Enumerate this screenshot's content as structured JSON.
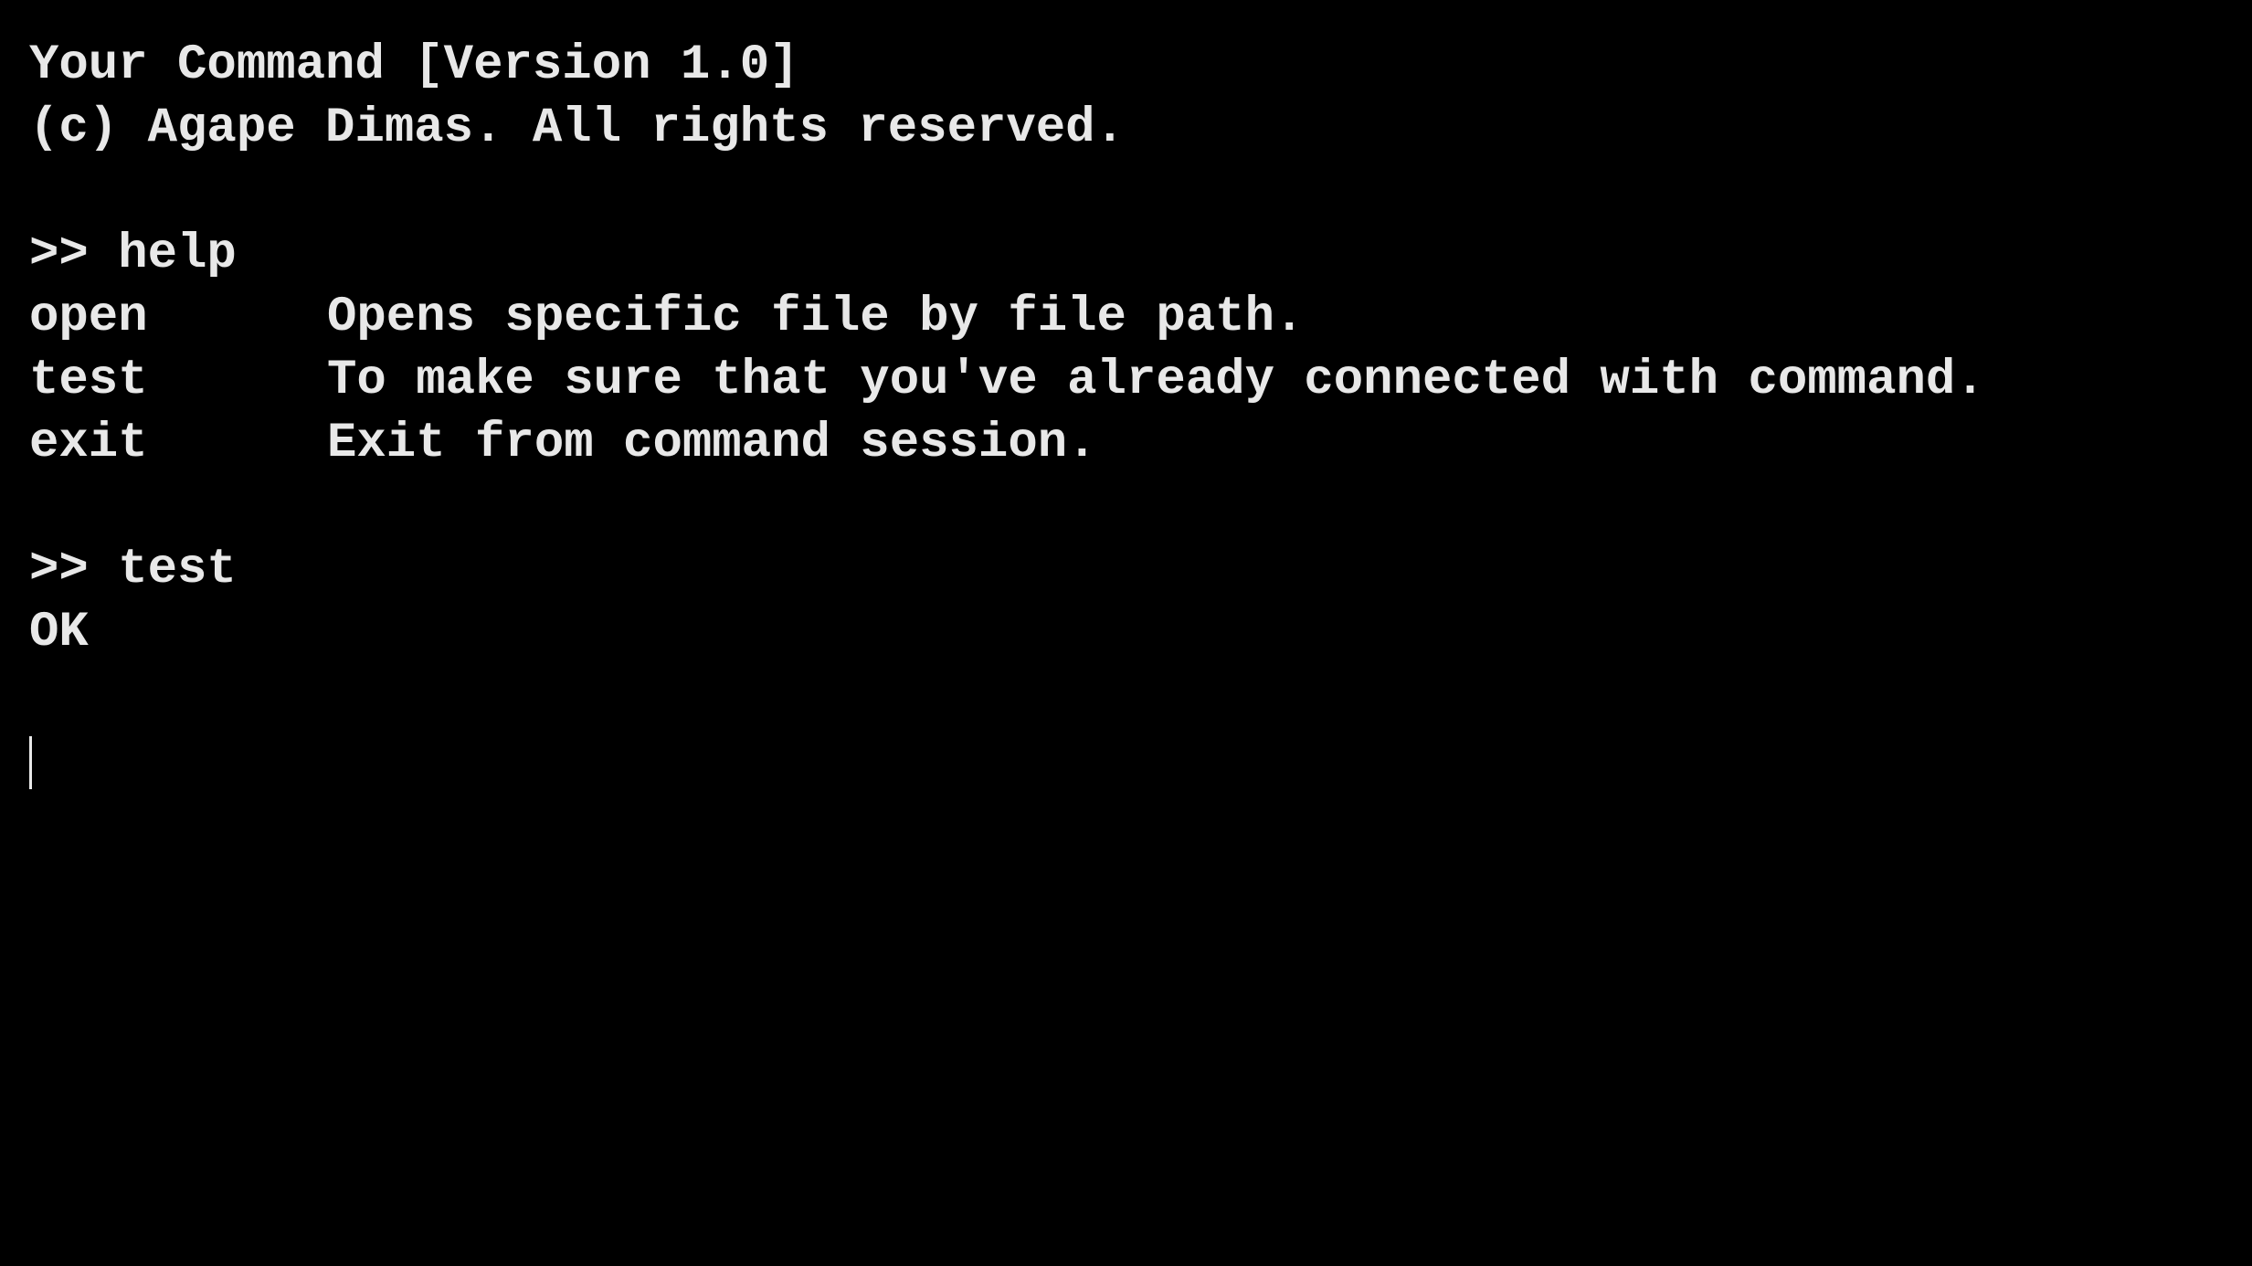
{
  "header": {
    "title_line": "Your Command [Version 1.0]",
    "copyright_line": "(c) Agape Dimas. All rights reserved."
  },
  "session": [
    {
      "prompt": ">> help",
      "output_commands": [
        {
          "name": "open",
          "description": "Opens specific file by file path."
        },
        {
          "name": "test",
          "description": "To make sure that you've already connected with command."
        },
        {
          "name": "exit",
          "description": "Exit from command session."
        }
      ]
    },
    {
      "prompt": ">> test",
      "output_text": "OK"
    }
  ],
  "input": {
    "value": ""
  },
  "colors": {
    "background": "#000000",
    "text": "#e8e8e8"
  }
}
